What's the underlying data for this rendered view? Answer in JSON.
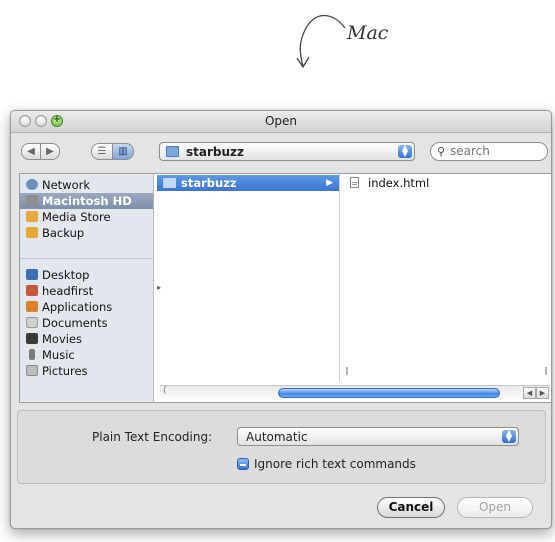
{
  "annotation": {
    "text": "Mac"
  },
  "window": {
    "title": "Open"
  },
  "toolbar": {
    "back_glyph": "◀",
    "forward_glyph": "▶",
    "list_view_glyph": "☰",
    "column_view_glyph": "▥",
    "path_label": "starbuzz",
    "search_placeholder": "search"
  },
  "sidebar": {
    "devices": [
      {
        "label": "Network",
        "icon": "globe-icon",
        "color": "#6a8fb8"
      },
      {
        "label": "Macintosh HD",
        "icon": "hard-drive-icon",
        "color": "#8f8f8f",
        "selected": true
      },
      {
        "label": "Media Store",
        "icon": "drive-icon",
        "color": "#e0a93a"
      },
      {
        "label": "Backup",
        "icon": "drive-icon",
        "color": "#e0a93a"
      }
    ],
    "places": [
      {
        "label": "Desktop",
        "icon": "desktop-icon",
        "color": "#3d6fb2"
      },
      {
        "label": "headfirst",
        "icon": "home-icon",
        "color": "#c0593a"
      },
      {
        "label": "Applications",
        "icon": "applications-icon",
        "color": "#d9822b"
      },
      {
        "label": "Documents",
        "icon": "documents-icon",
        "color": "#cfcfcf"
      },
      {
        "label": "Movies",
        "icon": "movies-icon",
        "color": "#3a3a3a"
      },
      {
        "label": "Music",
        "icon": "music-icon",
        "color": "#7a7a7a"
      },
      {
        "label": "Pictures",
        "icon": "pictures-icon",
        "color": "#bdbdbd"
      }
    ]
  },
  "columns": {
    "col1": {
      "folder": "starbuzz",
      "arrow": "▶"
    },
    "col2": {
      "file": "index.html"
    }
  },
  "options": {
    "encoding_label": "Plain Text Encoding:",
    "encoding_value": "Automatic",
    "ignore_rich_text_label": "Ignore rich text commands"
  },
  "buttons": {
    "cancel": "Cancel",
    "open": "Open"
  },
  "colors": {
    "selection_blue": "#3a74cf",
    "sidebar_bg": "#e3e8ef"
  }
}
